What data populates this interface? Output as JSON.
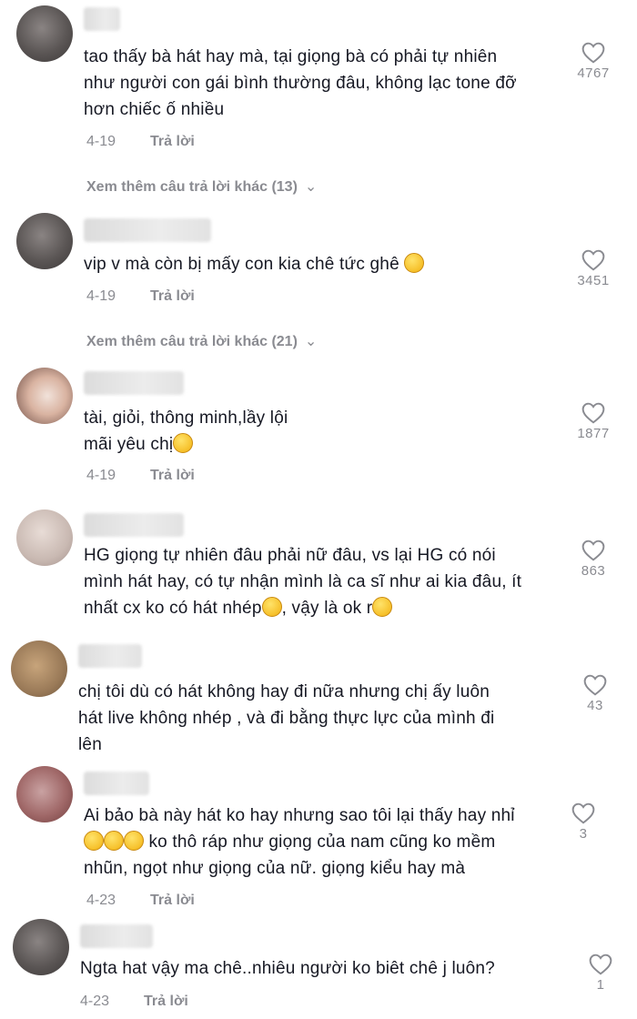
{
  "comments": [
    {
      "text_lines": [
        "tao thấy bà hát hay mà, tại giọng bà có phải tự nhiên",
        "như người con gái bình thường đâu, không lạc tone đỡ",
        "hơn chiếc ố nhiều"
      ],
      "date": "4-19",
      "reply_label": "Trả lời",
      "likes": "4767",
      "more_replies": "Xem thêm câu trả lời khác (13)"
    },
    {
      "text_lines": [
        "vip v mà còn bị mấy con kia chê tức ghê"
      ],
      "emoji": "smirk-emoji",
      "date": "4-19",
      "reply_label": "Trả lời",
      "likes": "3451",
      "more_replies": "Xem thêm câu trả lời khác (21)"
    },
    {
      "text_lines": [
        "tài, giỏi, thông minh,lầy lội",
        "mãi yêu chị"
      ],
      "emoji": "smiling-face-with-hearts-emoji",
      "date": "4-19",
      "reply_label": "Trả lời",
      "likes": "1877"
    },
    {
      "text_lines": [
        "HG giọng tự nhiên đâu phải nữ đâu, vs lại HG có nói",
        "mình hát hay, có tự nhận mình là ca sĩ như ai kia đâu, ít",
        "nhất cx ko có hát nhép",
        ", vậy là ok r"
      ],
      "emoji": "pensive-emoji",
      "likes": "863"
    },
    {
      "text_lines": [
        "chị tôi dù có hát không hay đi nữa nhưng chị ấy luôn",
        "hát live không nhép , và đi bằng thực lực của mình đi",
        "lên"
      ],
      "likes": "43"
    },
    {
      "text_lines": [
        "Ai bảo bà này hát ko hay nhưng sao tôi lại thấy hay nhỉ",
        "ko thô ráp như giọng của nam cũng ko mềm",
        "nhũn, ngọt như giọng của nữ. giọng kiểu hay mà"
      ],
      "emoji": "grinning-sweat-emoji",
      "date": "4-23",
      "reply_label": "Trả lời",
      "likes": "3"
    },
    {
      "text_lines": [
        "Ngta hat vậy ma chê..nhiêu người ko biêt chê j luôn?"
      ],
      "date": "4-23",
      "reply_label": "Trả lời",
      "likes": "1"
    }
  ],
  "icons": {
    "like": "heart-outline-icon",
    "expand": "chevron-down-icon"
  },
  "colors": {
    "text": "#161823",
    "muted": "#8a8b91"
  }
}
